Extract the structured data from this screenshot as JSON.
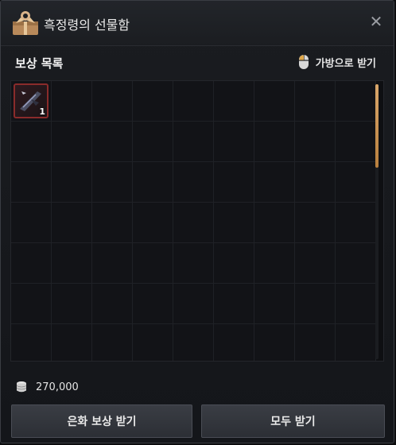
{
  "window": {
    "title": "흑정령의 선물함",
    "close_symbol": "✕"
  },
  "section": {
    "title": "보상 목록",
    "receive_to_bag_label": "가방으로 받기"
  },
  "grid": {
    "columns": 9,
    "rows": 7,
    "items": [
      {
        "icon": "dark-weapon-icon",
        "count": "1"
      }
    ]
  },
  "silver": {
    "amount": "270,000",
    "icon": "silver-coin-stack-icon"
  },
  "buttons": {
    "receive_silver": "은화 보상 받기",
    "receive_all": "모두 받기"
  },
  "colors": {
    "accent": "#c8914f",
    "item_border": "#8a2b2b"
  }
}
